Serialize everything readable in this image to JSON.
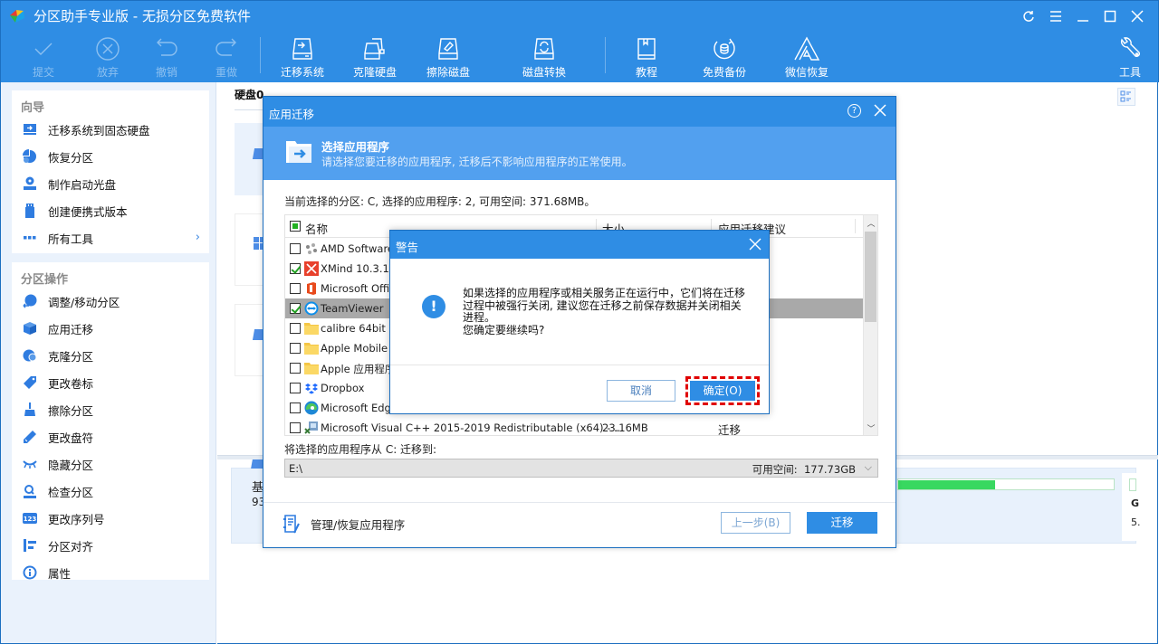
{
  "window": {
    "title": "分区助手专业版 - 无损分区免费软件",
    "controls": [
      "refresh-icon",
      "menu-icon",
      "minimize-icon",
      "maximize-icon",
      "close-icon"
    ]
  },
  "toolbar": {
    "items": [
      {
        "label": "提交",
        "icon": "check-icon",
        "enabled": false
      },
      {
        "label": "放弃",
        "icon": "discard-icon",
        "enabled": false
      },
      {
        "label": "撤销",
        "icon": "undo-icon",
        "enabled": false
      },
      {
        "label": "重做",
        "icon": "redo-icon",
        "enabled": false
      },
      {
        "label": "迁移系统",
        "icon": "migrate-os-icon",
        "enabled": true
      },
      {
        "label": "克隆硬盘",
        "icon": "clone-disk-icon",
        "enabled": true
      },
      {
        "label": "擦除磁盘",
        "icon": "wipe-disk-icon",
        "enabled": true
      },
      {
        "label": "磁盘转换",
        "icon": "convert-disk-icon",
        "enabled": true
      },
      {
        "label": "教程",
        "icon": "book-icon",
        "enabled": true
      },
      {
        "label": "免费备份",
        "icon": "backup-icon",
        "enabled": true
      },
      {
        "label": "微信恢复",
        "icon": "wechat-recovery-icon",
        "enabled": true
      },
      {
        "label": "工具",
        "icon": "wrench-icon",
        "enabled": true
      }
    ]
  },
  "sidebar": {
    "wizard": {
      "title": "向导",
      "items": [
        {
          "label": "迁移系统到固态硬盘",
          "icon": "migrate-ssd-icon"
        },
        {
          "label": "恢复分区",
          "icon": "recover-partition-icon"
        },
        {
          "label": "制作启动光盘",
          "icon": "bootable-media-icon"
        },
        {
          "label": "创建便携式版本",
          "icon": "usb-icon"
        },
        {
          "label": "所有工具",
          "icon": "more-icon"
        }
      ]
    },
    "partition_ops": {
      "title": "分区操作",
      "items": [
        {
          "label": "调整/移动分区",
          "icon": "resize-icon"
        },
        {
          "label": "应用迁移",
          "icon": "app-move-icon"
        },
        {
          "label": "克隆分区",
          "icon": "clone-partition-icon"
        },
        {
          "label": "更改卷标",
          "icon": "tag-icon"
        },
        {
          "label": "擦除分区",
          "icon": "wipe-icon"
        },
        {
          "label": "更改盘符",
          "icon": "pencil-icon"
        },
        {
          "label": "隐藏分区",
          "icon": "hide-eye-icon"
        },
        {
          "label": "检查分区",
          "icon": "check-partition-icon"
        },
        {
          "label": "更改序列号",
          "icon": "serial-123-icon"
        },
        {
          "label": "分区对齐",
          "icon": "align-icon"
        },
        {
          "label": "属性",
          "icon": "info-icon"
        }
      ]
    }
  },
  "main": {
    "disk_label": "硬盘0",
    "disk_summary": {
      "label": "基",
      "size": "93"
    },
    "right_card": {
      "line1": "G",
      "line2": "5."
    },
    "usage_fraction": 0.45
  },
  "app_dialog": {
    "title": "应用迁移",
    "header_title": "选择应用程序",
    "header_subtitle": "请选择您要迁移的应用程序, 迁移后不影响应用程序的正常使用。",
    "info": "当前选择的分区: C, 选择的应用程序: 2, 可用空间: 371.68MB。",
    "columns": {
      "name": "名称",
      "size": "大小",
      "suggestion": "应用迁移建议"
    },
    "apps": [
      {
        "name": "AMD Software",
        "size": "",
        "suggestion": "",
        "checked": false,
        "icon": "amd-icon"
      },
      {
        "name": "XMind 10.3.1",
        "size": "",
        "suggestion": "",
        "checked": true,
        "icon": "xmind-icon"
      },
      {
        "name": "Microsoft Office",
        "size": "",
        "suggestion": "",
        "checked": false,
        "icon": "office-icon"
      },
      {
        "name": "TeamViewer",
        "size": "",
        "suggestion": "",
        "checked": true,
        "icon": "teamviewer-icon",
        "highlighted": true
      },
      {
        "name": "calibre 64bit",
        "size": "",
        "suggestion": "",
        "checked": false,
        "icon": "folder-icon"
      },
      {
        "name": "Apple Mobile De",
        "size": "",
        "suggestion": "",
        "checked": false,
        "icon": "folder-icon"
      },
      {
        "name": "Apple 应用程序",
        "size": "",
        "suggestion": "",
        "checked": false,
        "icon": "folder-icon"
      },
      {
        "name": "Dropbox",
        "size": "",
        "suggestion": "",
        "checked": false,
        "icon": "dropbox-icon"
      },
      {
        "name": "Microsoft Edge",
        "size": "",
        "suggestion": "",
        "checked": false,
        "icon": "edge-icon"
      },
      {
        "name": "Microsoft Visual C++ 2015-2019 Redistributable (x64) - ...",
        "size": "23.16MB",
        "suggestion": "迁移",
        "checked": false,
        "icon": "installer-icon"
      }
    ],
    "dest_label": "将选择的应用程序从 C: 迁移到:",
    "dest_value": "E:\\",
    "dest_free_label": "可用空间:",
    "dest_free_value": "177.73GB",
    "manage_label": "管理/恢复应用程序",
    "prev_button": "上一步(B)",
    "migrate_button": "迁移"
  },
  "warning_dialog": {
    "title": "警告",
    "message_lines": [
      "如果选择的应用程序或相关服务正在运行中，它们将在迁移",
      "过程中被强行关闭, 建议您在迁移之前保存数据并关闭相关",
      "进程。",
      "您确定要继续吗?"
    ],
    "cancel_button": "取消",
    "ok_button": "确定(O)"
  },
  "colors": {
    "brand_blue": "#2f8de4",
    "header_blue": "#52a0ef",
    "highlight_red": "#e00000",
    "usage_green": "#38d860"
  }
}
